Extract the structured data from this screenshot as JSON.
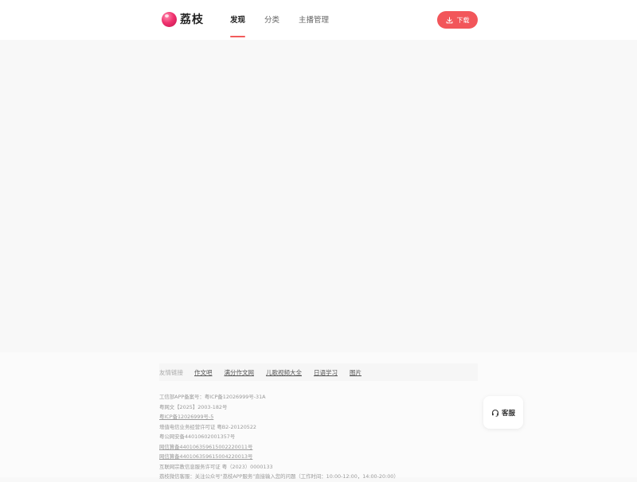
{
  "header": {
    "logo_text": "荔枝",
    "nav": [
      {
        "label": "发现",
        "active": true
      },
      {
        "label": "分类",
        "active": false
      },
      {
        "label": "主播管理",
        "active": false
      }
    ],
    "download_label": "下载",
    "accent_color": "#f2565a"
  },
  "footer": {
    "friend_links_label": "友情链接",
    "friend_links": [
      "作文吧",
      "满分作文网",
      "儿歌视频大全",
      "日语学习",
      "图片"
    ],
    "legal_lines": [
      "工信部APP备案号：粤ICP备12026999号-31A",
      "粤网文【2025】2003-182号",
      "粤ICP备12026999号-5",
      "增值电信业务经营许可证 粤B2-20120522",
      "粤公网安备44010602001357号",
      "网信算备440106359615002220011号",
      "网信算备440106359615004220013号",
      "互联网宗教信息服务许可证 粤（2023）0000133",
      "荔枝微信客服：关注公众号\"荔枝APP服务\"直接输入您的问题（工作时间：10:00-12:00，14:00-20:00）"
    ]
  },
  "service_button": {
    "label": "客服",
    "icon": "headset-icon"
  }
}
